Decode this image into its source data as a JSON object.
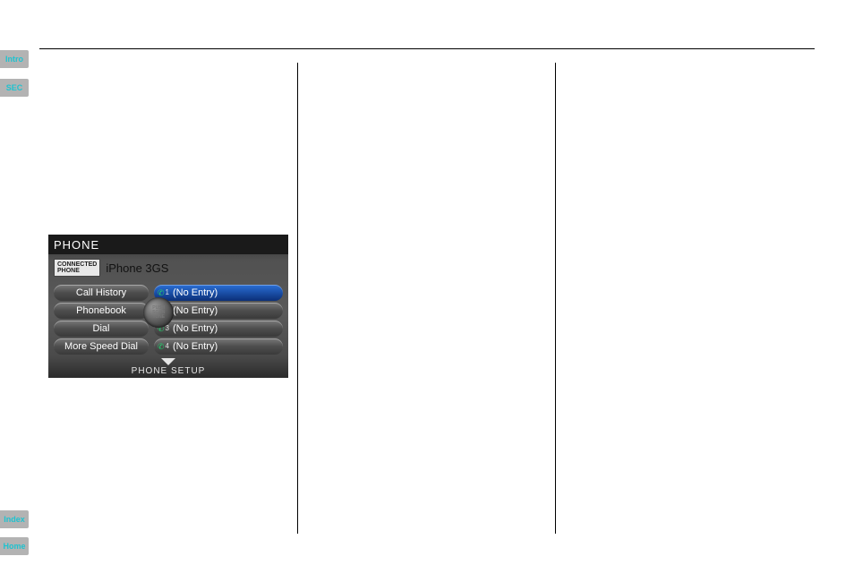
{
  "side_tabs": {
    "intro": "Intro",
    "sec": "SEC",
    "index": "Index",
    "home": "Home"
  },
  "phone_screen": {
    "title": "PHONE",
    "connected_label": "CONNECTED\nPHONE",
    "connected_device": "iPhone 3GS",
    "left_menu": {
      "call_history": "Call History",
      "phonebook": "Phonebook",
      "dial": "Dial",
      "more_speed_dial": "More Speed Dial"
    },
    "dial_center": "PUSH\nSCAN\nTUNE",
    "speed_dial": [
      {
        "idx": "1",
        "label": "(No Entry)",
        "selected": true
      },
      {
        "idx": "2",
        "label": "(No Entry)",
        "selected": false
      },
      {
        "idx": "3",
        "label": "(No Entry)",
        "selected": false
      },
      {
        "idx": "4",
        "label": "(No Entry)",
        "selected": false
      }
    ],
    "phone_setup": "PHONE SETUP"
  }
}
